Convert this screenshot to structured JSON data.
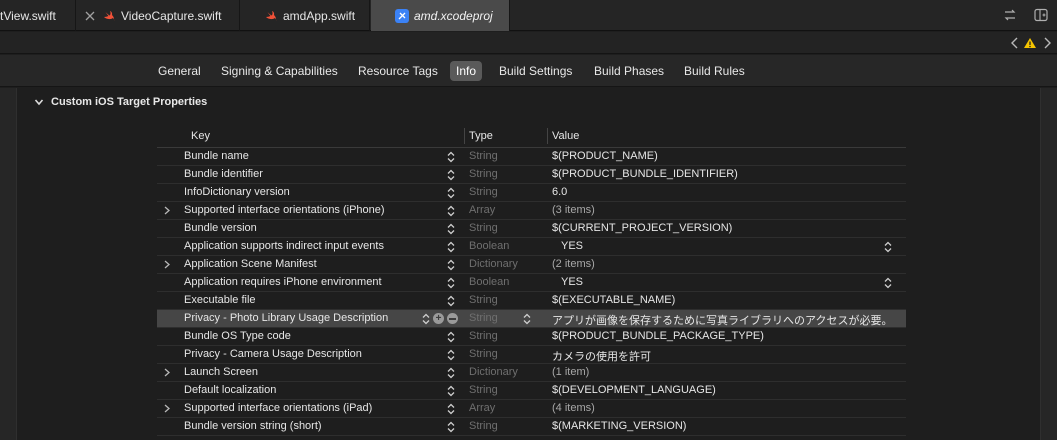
{
  "tabs": [
    {
      "label": "tView.swift",
      "active": false
    },
    {
      "label": "VideoCapture.swift",
      "active": false
    },
    {
      "label": "amdApp.swift",
      "active": false
    },
    {
      "label": "amd.xcodeproj",
      "active": true
    }
  ],
  "editor_tabs": [
    "General",
    "Signing & Capabilities",
    "Resource Tags",
    "Info",
    "Build Settings",
    "Build Phases",
    "Build Rules"
  ],
  "active_editor_tab": "Info",
  "section": {
    "title": "Custom iOS Target Properties"
  },
  "table": {
    "headers": {
      "key": "Key",
      "type": "Type",
      "value": "Value"
    },
    "rows": [
      {
        "key": "Bundle name",
        "type": "String",
        "value": "$(PRODUCT_NAME)",
        "expandable": false
      },
      {
        "key": "Bundle identifier",
        "type": "String",
        "value": "$(PRODUCT_BUNDLE_IDENTIFIER)",
        "expandable": false
      },
      {
        "key": "InfoDictionary version",
        "type": "String",
        "value": "6.0",
        "expandable": false
      },
      {
        "key": "Supported interface orientations (iPhone)",
        "type": "Array",
        "value": "(3 items)",
        "expandable": true
      },
      {
        "key": "Bundle version",
        "type": "String",
        "value": "$(CURRENT_PROJECT_VERSION)",
        "expandable": false
      },
      {
        "key": "Application supports indirect input events",
        "type": "Boolean",
        "value": "YES",
        "expandable": false
      },
      {
        "key": "Application Scene Manifest",
        "type": "Dictionary",
        "value": "(2 items)",
        "expandable": true
      },
      {
        "key": "Application requires iPhone environment",
        "type": "Boolean",
        "value": "YES",
        "expandable": false
      },
      {
        "key": "Executable file",
        "type": "String",
        "value": "$(EXECUTABLE_NAME)",
        "expandable": false
      },
      {
        "key": "Privacy - Photo Library Usage Description",
        "type": "String",
        "value": "アプリが画像を保存するために写真ライブラリへのアクセスが必要。",
        "expandable": false,
        "selected": true
      },
      {
        "key": "Bundle OS Type code",
        "type": "String",
        "value": "$(PRODUCT_BUNDLE_PACKAGE_TYPE)",
        "expandable": false
      },
      {
        "key": "Privacy - Camera Usage Description",
        "type": "String",
        "value": "カメラの使用を許可",
        "expandable": false
      },
      {
        "key": "Launch Screen",
        "type": "Dictionary",
        "value": "(1 item)",
        "expandable": true
      },
      {
        "key": "Default localization",
        "type": "String",
        "value": "$(DEVELOPMENT_LANGUAGE)",
        "expandable": false
      },
      {
        "key": "Supported interface orientations (iPad)",
        "type": "Array",
        "value": "(4 items)",
        "expandable": true
      },
      {
        "key": "Bundle version string (short)",
        "type": "String",
        "value": "$(MARKETING_VERSION)",
        "expandable": false
      }
    ]
  },
  "colors": {
    "accent": "#3b82f6",
    "swift": "#f05138",
    "warning": "#f5c400"
  }
}
